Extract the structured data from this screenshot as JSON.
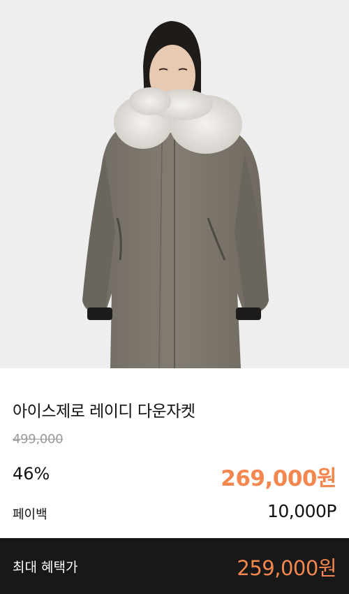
{
  "product": {
    "image_alt": "model wearing grey-brown hooded down coat with fur trim",
    "name": "아이스제로 레이디 다운자켓",
    "original_price": "499,000",
    "discount_rate": "46%",
    "sale_price": "269,000원"
  },
  "paypoint": {
    "label": "페이백",
    "value": "10,000P"
  },
  "benefit": {
    "label": "최대 혜택가",
    "price": "259,000원"
  },
  "colors": {
    "accent": "#f4874f",
    "bar_bg": "#181818",
    "coat": "#7b756c"
  }
}
